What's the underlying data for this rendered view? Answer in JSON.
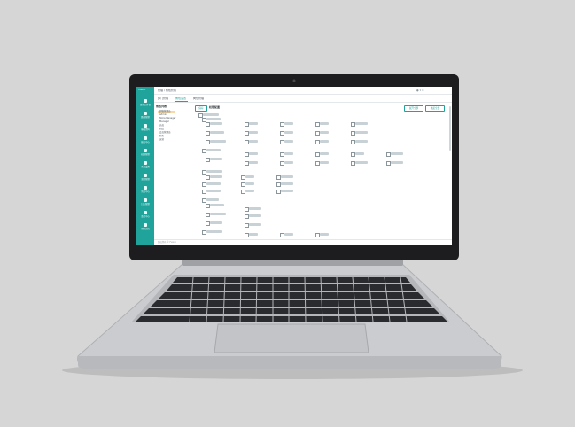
{
  "app": {
    "logo": "Fusion",
    "breadcrumb": "管理 / 角色管理",
    "tabs": [
      {
        "label": "部门管理"
      },
      {
        "label": "角色设置"
      },
      {
        "label": "岗位管理"
      }
    ],
    "sidebar": [
      "首页工作台",
      "数据管理",
      "基础资料",
      "报表中心",
      "权限管理",
      "系统设置",
      "流程管理",
      "消息中心",
      "日志管理",
      "监控中心",
      "帮助文档"
    ],
    "left_panel": {
      "title": "角色列表",
      "items": [
        "超级管理员",
        "Admin",
        "Store Manager",
        "Manager",
        "店员",
        "商品",
        "会员管理员",
        "财务",
        "运营"
      ]
    },
    "main": {
      "title": "权限配置",
      "save_button": "保存",
      "top_buttons": [
        "展开全部",
        "收起全部"
      ]
    },
    "footer": "版权所有 © Fusion"
  },
  "colors": {
    "accent": "#1fa39b",
    "background": "#d6d6d6",
    "laptop_lid": "#1d1d1f",
    "laptop_body": "#c9cacd"
  }
}
